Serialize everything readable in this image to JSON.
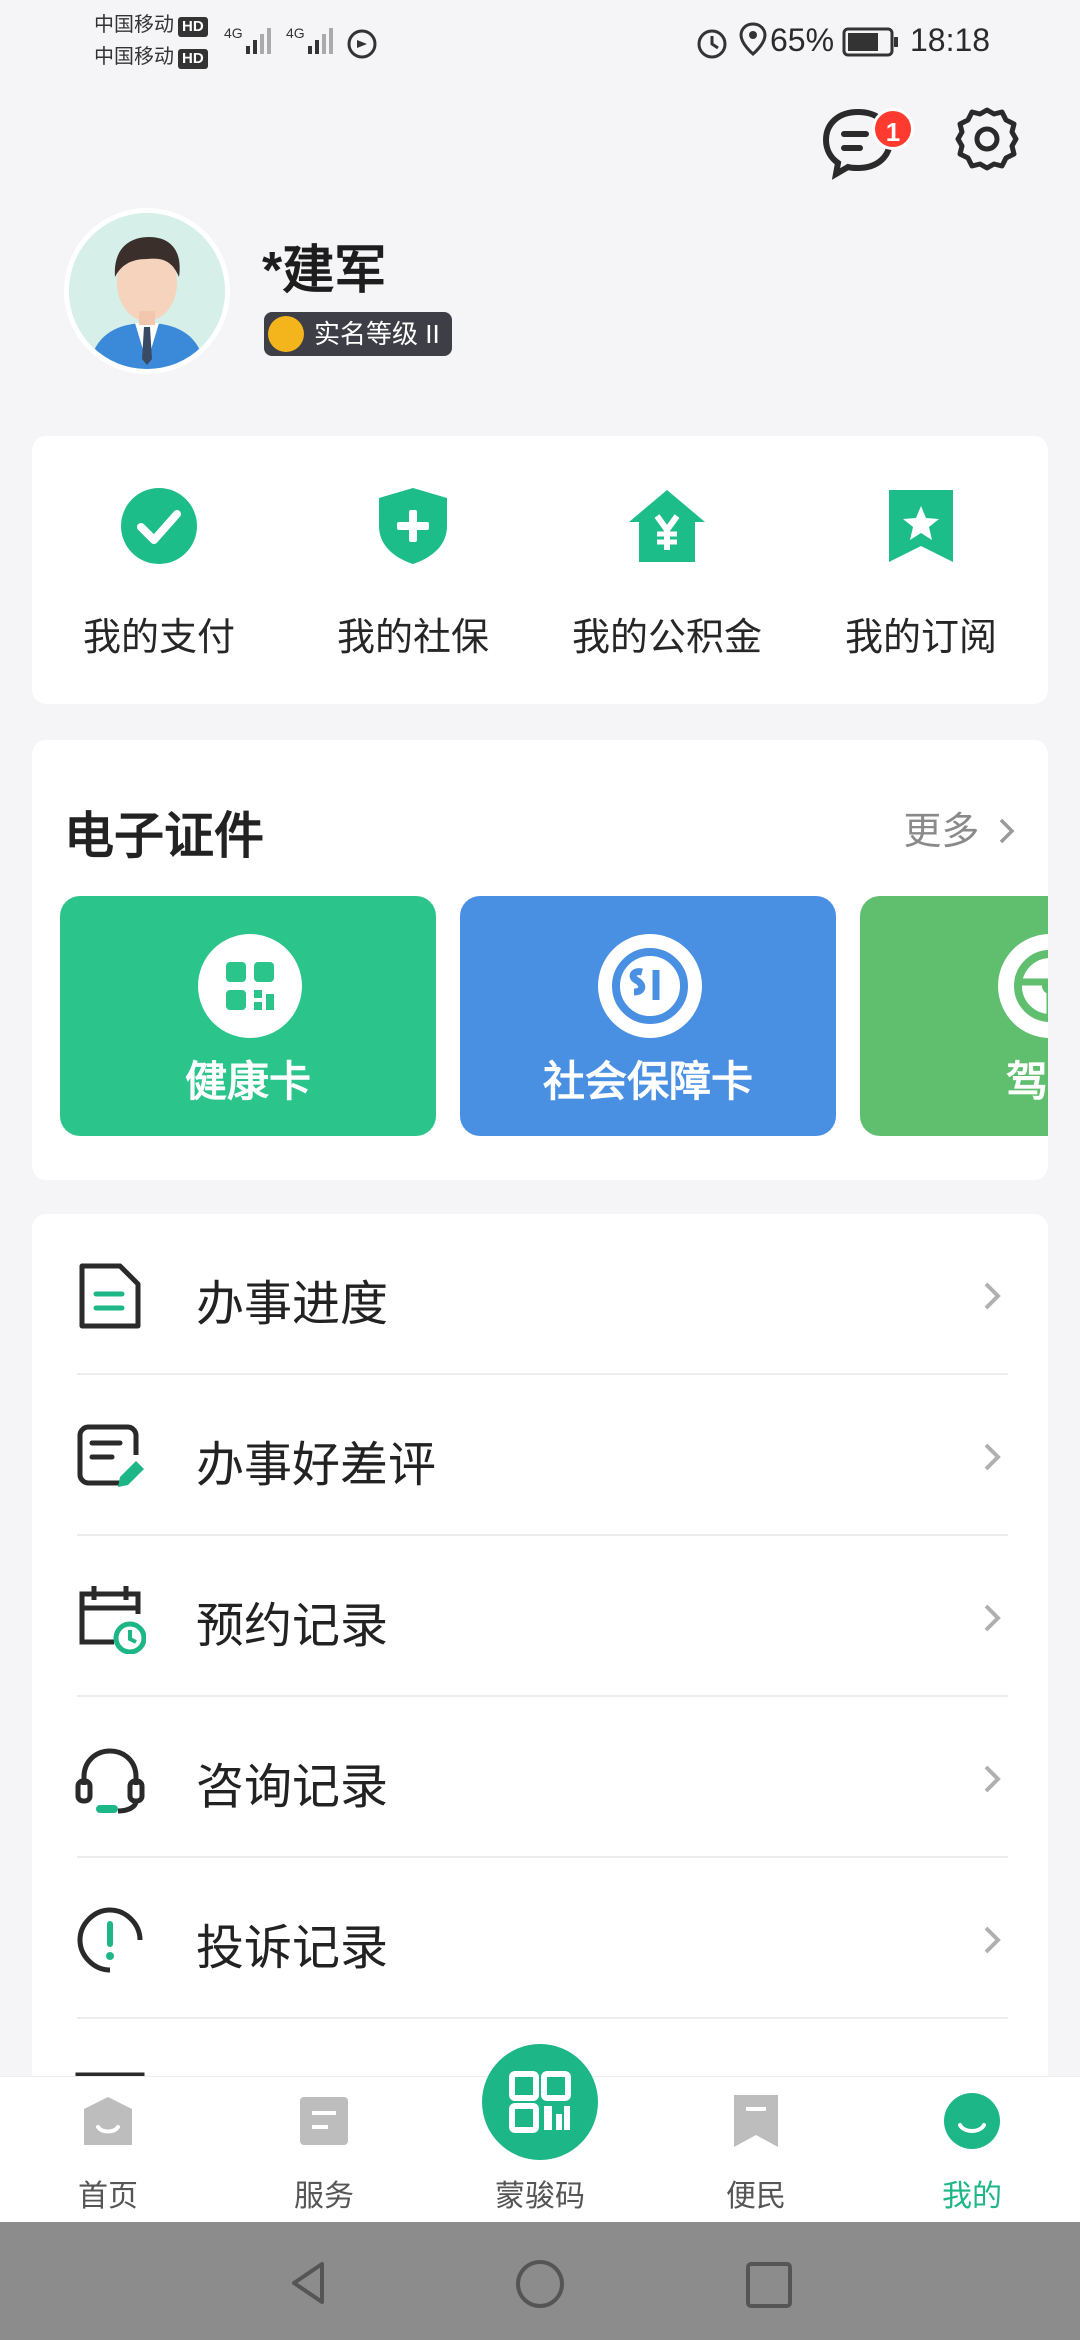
{
  "status_bar": {
    "carrier1": "中国移动",
    "carrier2": "中国移动",
    "hd": "HD",
    "net": "4G",
    "battery": "65%",
    "time": "18:18"
  },
  "header": {
    "badge_count": "1",
    "username": "*建军",
    "realname_level": "实名等级 II"
  },
  "shortcuts": [
    {
      "label": "我的支付",
      "icon": "check-circle-icon"
    },
    {
      "label": "我的社保",
      "icon": "shield-plus-icon"
    },
    {
      "label": "我的公积金",
      "icon": "house-yuan-icon"
    },
    {
      "label": "我的订阅",
      "icon": "bookmark-star-icon"
    }
  ],
  "certs": {
    "title": "电子证件",
    "more": "更多",
    "cards": [
      {
        "label": "健康卡",
        "color": "#2bc48b",
        "icon": "qr-grid-icon"
      },
      {
        "label": "社会保障卡",
        "color": "#4a90e2",
        "icon": "si-logo-icon"
      },
      {
        "label": "驾驶",
        "color": "#5fbf6f",
        "icon": "steering-wheel-icon"
      }
    ]
  },
  "list": [
    {
      "label": "办事进度",
      "icon": "document-progress-icon"
    },
    {
      "label": "办事好差评",
      "icon": "review-edit-icon"
    },
    {
      "label": "预约记录",
      "icon": "calendar-clock-icon"
    },
    {
      "label": "咨询记录",
      "icon": "headset-icon"
    },
    {
      "label": "投诉记录",
      "icon": "alert-circle-icon"
    }
  ],
  "nav": {
    "items": [
      {
        "label": "首页",
        "icon": "home-icon"
      },
      {
        "label": "服务",
        "icon": "service-icon"
      },
      {
        "label": "蒙骏码",
        "icon": "qr-code-icon"
      },
      {
        "label": "便民",
        "icon": "bookmark-icon"
      },
      {
        "label": "我的",
        "icon": "profile-icon"
      }
    ],
    "active_color": "#1db686"
  },
  "theme": {
    "accent": "#1db686"
  }
}
